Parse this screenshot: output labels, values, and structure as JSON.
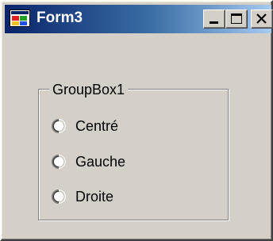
{
  "window": {
    "title": "Form3",
    "icon": "form-app-icon",
    "buttons": {
      "minimize_label": "_",
      "maximize_label": "□",
      "close_label": "X"
    }
  },
  "groupbox": {
    "label": "GroupBox1",
    "options": [
      {
        "label": "Centré",
        "checked": false
      },
      {
        "label": "Gauche",
        "checked": false
      },
      {
        "label": "Droite",
        "checked": false
      }
    ]
  },
  "colors": {
    "face": "#d4d0c8",
    "title_gradient_start": "#0a246a",
    "title_gradient_end": "#a6caf0"
  }
}
